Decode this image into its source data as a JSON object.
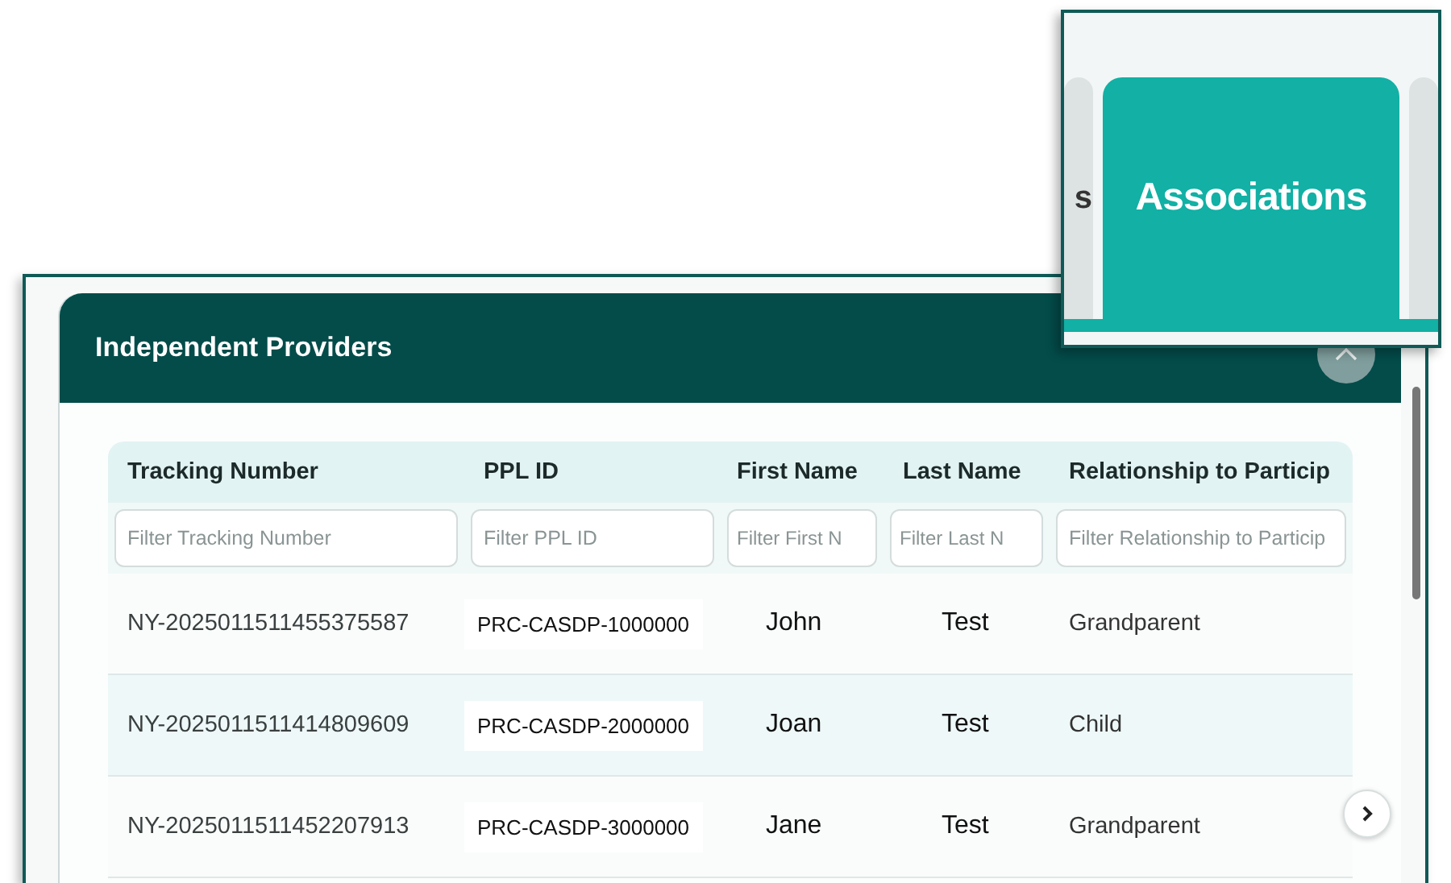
{
  "dialog": {
    "title": "Independent Providers"
  },
  "table": {
    "columns": [
      {
        "label": "Tracking Number",
        "filter_placeholder": "Filter Tracking Number"
      },
      {
        "label": "PPL ID",
        "filter_placeholder": "Filter PPL ID"
      },
      {
        "label": "First Name",
        "filter_placeholder": "Filter First N"
      },
      {
        "label": "Last Name",
        "filter_placeholder": "Filter Last N"
      },
      {
        "label": "Relationship to Particip",
        "filter_placeholder": "Filter Relationship to Particip"
      }
    ],
    "rows": [
      {
        "cells": [
          "NY-2025011511455375587",
          "PRC-CASDP-1000000",
          "John",
          "Test",
          "Grandparent"
        ]
      },
      {
        "cells": [
          "NY-2025011511414809609",
          "PRC-CASDP-2000000",
          "Joan",
          "Test",
          "Child"
        ]
      },
      {
        "cells": [
          "NY-2025011511452207913",
          "PRC-CASDP-3000000",
          "Jane",
          "Test",
          "Grandparent"
        ]
      }
    ]
  },
  "inset": {
    "tabs": [
      {
        "label": "s",
        "selected": false
      },
      {
        "label": "Associations",
        "selected": true
      },
      {
        "selected": false
      }
    ]
  }
}
